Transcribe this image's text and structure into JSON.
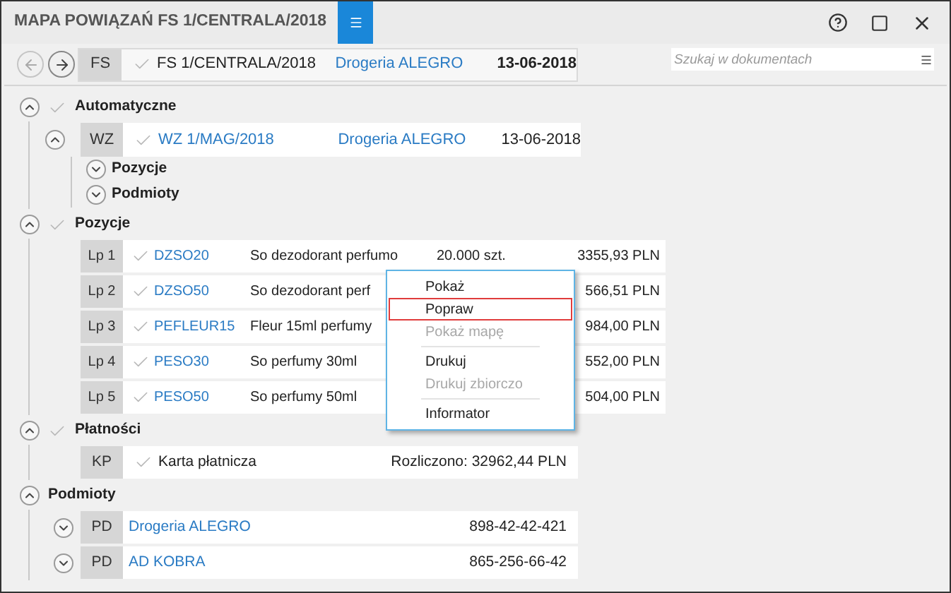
{
  "window": {
    "title": "MAPA POWIĄZAŃ FS 1/CENTRALA/2018"
  },
  "document": {
    "type": "FS",
    "number": "FS 1/CENTRALA/2018",
    "contractor": "Drogeria ALEGRO",
    "date": "13-06-2018"
  },
  "search": {
    "placeholder": "Szukaj w dokumentach"
  },
  "sections": [
    {
      "kind": "documents",
      "title": "Automatyczne",
      "expanded": true,
      "verified": true,
      "items": [
        {
          "type": "WZ",
          "number": "WZ 1/MAG/2018",
          "contractor": "Drogeria ALEGRO",
          "date": "13-06-2018",
          "expanded": true,
          "subsections": [
            {
              "title": "Pozycje",
              "expanded": false
            },
            {
              "title": "Podmioty",
              "expanded": false
            }
          ]
        }
      ]
    },
    {
      "kind": "positions",
      "title": "Pozycje",
      "expanded": true,
      "verified": true,
      "items": [
        {
          "lp": "Lp 1",
          "code": "DZSO20",
          "name": "So dezodorant perfumo",
          "quantity": "20.000 szt.",
          "amount": "3355,93 PLN"
        },
        {
          "lp": "Lp 2",
          "code": "DZSO50",
          "name": "So dezodorant perf",
          "amount": "566,51 PLN"
        },
        {
          "lp": "Lp 3",
          "code": "PEFLEUR15",
          "name": "Fleur 15ml perfumy",
          "amount": "984,00 PLN"
        },
        {
          "lp": "Lp 4",
          "code": "PESO30",
          "name": "So perfumy 30ml",
          "amount": "552,00 PLN"
        },
        {
          "lp": "Lp 5",
          "code": "PESO50",
          "name": "So perfumy 50ml",
          "amount": "504,00 PLN"
        }
      ]
    },
    {
      "kind": "payments",
      "title": "Płatności",
      "expanded": true,
      "verified": true,
      "items": [
        {
          "type": "KP",
          "name": "Karta płatnicza",
          "amount": "Rozliczono: 32962,44 PLN"
        }
      ]
    },
    {
      "kind": "subjects",
      "title": "Podmioty",
      "expanded": true,
      "verified": false,
      "items": [
        {
          "type": "PD",
          "name": "Drogeria ALEGRO",
          "nip": "898-42-42-421",
          "expanded": false
        },
        {
          "type": "PD",
          "name": "AD KOBRA",
          "nip": "865-256-66-42",
          "expanded": false
        }
      ]
    }
  ],
  "context_menu": {
    "items": [
      {
        "kind": "item",
        "label": "Pokaż",
        "disabled": false,
        "selected": false
      },
      {
        "kind": "item",
        "label": "Popraw",
        "disabled": false,
        "selected": true
      },
      {
        "kind": "item",
        "label": "Pokaż mapę",
        "disabled": true,
        "selected": false
      },
      {
        "kind": "separator"
      },
      {
        "kind": "item",
        "label": "Drukuj",
        "disabled": false,
        "selected": false
      },
      {
        "kind": "item",
        "label": "Drukuj zbiorczo",
        "disabled": true,
        "selected": false
      },
      {
        "kind": "separator"
      },
      {
        "kind": "item",
        "label": "Informator",
        "disabled": false,
        "selected": false
      }
    ]
  }
}
